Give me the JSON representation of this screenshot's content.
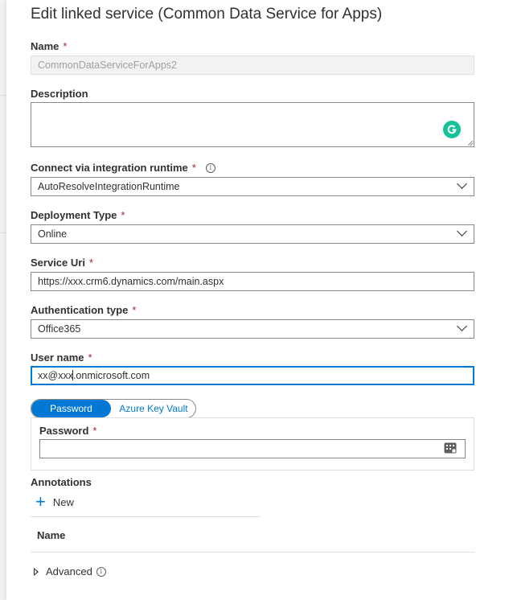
{
  "panel": {
    "title": "Edit linked service (Common Data Service for Apps)"
  },
  "form": {
    "required_marker": "*",
    "name": {
      "label": "Name",
      "value": "CommonDataServiceForApps2"
    },
    "description": {
      "label": "Description",
      "value": ""
    },
    "integration_runtime": {
      "label": "Connect via integration runtime",
      "value": "AutoResolveIntegrationRuntime"
    },
    "deployment_type": {
      "label": "Deployment Type",
      "value": "Online"
    },
    "service_uri": {
      "label": "Service Uri",
      "value": "https://xxx.crm6.dynamics.com/main.aspx"
    },
    "auth_type": {
      "label": "Authentication type",
      "value": "Office365"
    },
    "user_name": {
      "label": "User name",
      "value_before_caret": "xx@xxx",
      "value_after_caret": ".onmicrosoft.com"
    },
    "password_source": {
      "options": [
        "Password",
        "Azure Key Vault"
      ],
      "selected": "Password"
    },
    "password": {
      "label": "Password",
      "value": ""
    }
  },
  "annotations": {
    "label": "Annotations",
    "add_label": "New",
    "column_header": "Name"
  },
  "advanced": {
    "label": "Advanced"
  },
  "icons": {
    "info": "info-icon",
    "chevron": "chevron-down-icon",
    "grammarly": "grammarly-icon",
    "password_keypad": "keypad-icon",
    "add": "plus-icon",
    "expand": "expand-triangle-icon"
  },
  "colors": {
    "accent": "#0078d4",
    "required": "#a4262c",
    "grammarly": "#15c39a",
    "border": "#8a8886"
  }
}
